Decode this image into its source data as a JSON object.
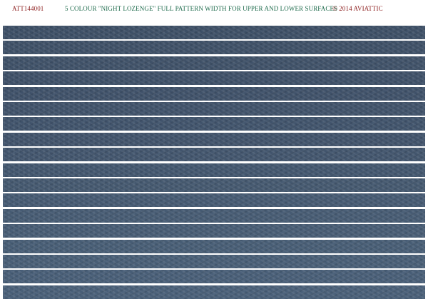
{
  "header": {
    "code": "ATT144001",
    "title": "5 COLOUR \"NIGHT LOZENGE\" FULL PATTERN WIDTH FOR UPPER AND LOWER SURFACES",
    "copyright": "© 2014 AVIATTIC"
  },
  "stripes": [
    {
      "color": "#3d4f66"
    },
    {
      "color": "#3e5067"
    },
    {
      "color": "#3f5168"
    },
    {
      "color": "#3e5068"
    },
    {
      "color": "#3f5169"
    },
    {
      "color": "#40526a"
    },
    {
      "color": "#40536b"
    },
    {
      "color": "#41536b"
    },
    {
      "color": "#42556d"
    },
    {
      "color": "#42566e"
    },
    {
      "color": "#44586f"
    },
    {
      "color": "#455a72"
    },
    {
      "color": "#465b73"
    },
    {
      "color": "#475c74"
    },
    {
      "color": "#475d75"
    },
    {
      "color": "#485e76"
    },
    {
      "color": "#485e77"
    },
    {
      "color": "#495f78"
    }
  ]
}
